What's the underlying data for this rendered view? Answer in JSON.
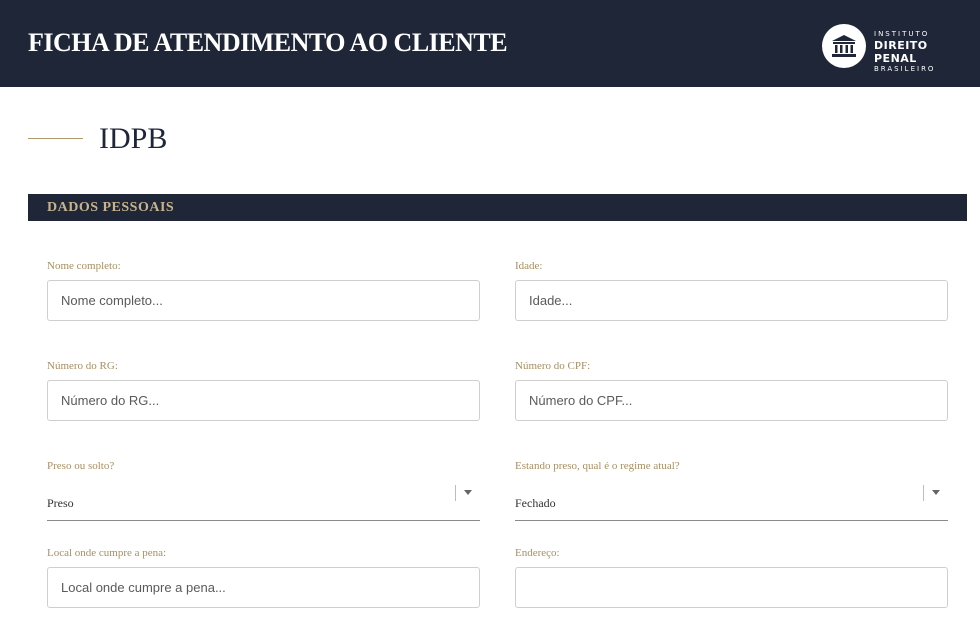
{
  "header": {
    "title": "FICHA DE ATENDIMENTO AO CLIENTE",
    "logo": {
      "icon": "courthouse-icon",
      "line1": "INSTITUTO",
      "line2": "DIREITO PENAL",
      "line3": "BRASILEIRO"
    }
  },
  "page": {
    "heading": "IDPB"
  },
  "section": {
    "title": "DADOS PESSOAIS"
  },
  "form": {
    "nome": {
      "label": "Nome completo:",
      "placeholder": "Nome completo..."
    },
    "idade": {
      "label": "Idade:",
      "placeholder": "Idade..."
    },
    "rg": {
      "label": "Número do RG:",
      "placeholder": "Número do RG..."
    },
    "cpf": {
      "label": "Número do CPF:",
      "placeholder": "Número do CPF..."
    },
    "preso": {
      "label": "Preso ou solto?",
      "value": "Preso"
    },
    "regime": {
      "label": "Estando preso, qual é o regime atual?",
      "value": "Fechado"
    },
    "local": {
      "label": "Local onde cumpre a pena:",
      "placeholder": "Local onde cumpre a pena..."
    },
    "endereco": {
      "label": "Endereço:",
      "placeholder": ""
    }
  },
  "colors": {
    "navy": "#1e2638",
    "gold": "#a88f5f"
  }
}
